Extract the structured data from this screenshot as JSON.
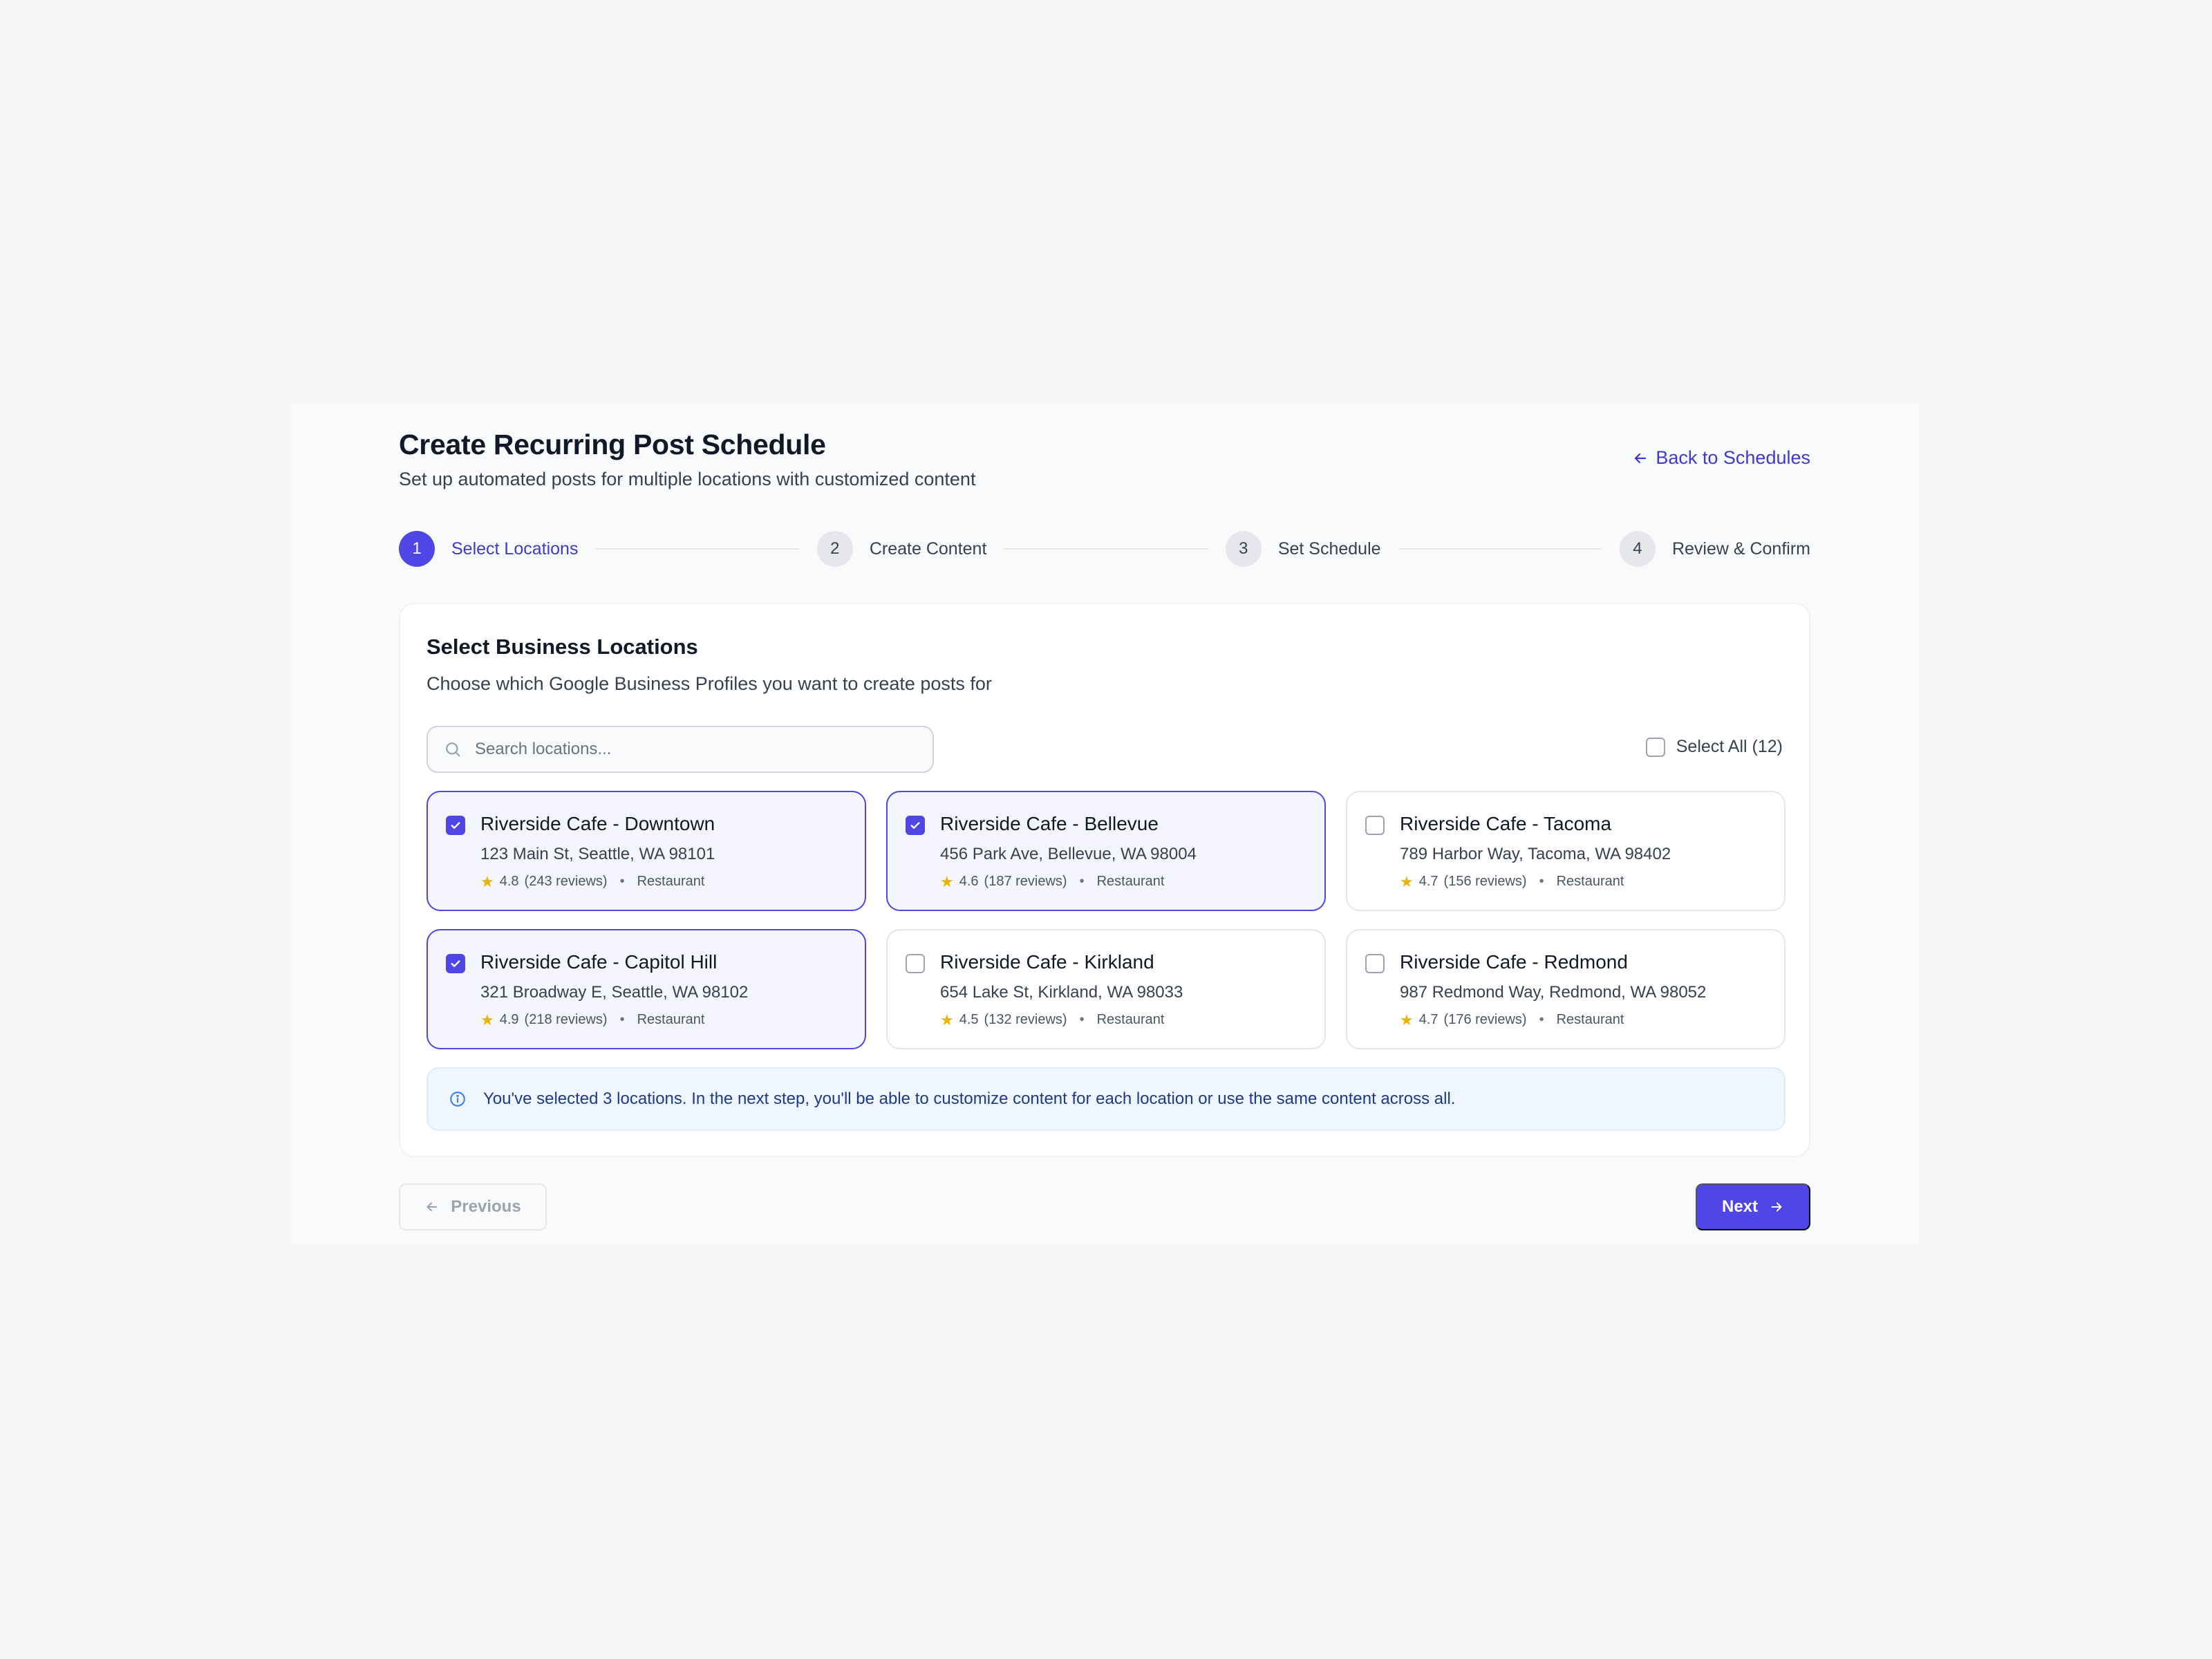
{
  "header": {
    "title": "Create Recurring Post Schedule",
    "subtitle": "Set up automated posts for multiple locations with customized content",
    "back_link": "Back to Schedules"
  },
  "stepper": {
    "current_step": 1,
    "steps": [
      {
        "number": "1",
        "label": "Select Locations"
      },
      {
        "number": "2",
        "label": "Create Content"
      },
      {
        "number": "3",
        "label": "Set Schedule"
      },
      {
        "number": "4",
        "label": "Review & Confirm"
      }
    ]
  },
  "card": {
    "title": "Select Business Locations",
    "subtitle": "Choose which Google Business Profiles you want to create posts for",
    "search_placeholder": "Search locations...",
    "select_all_label": "Select All (12)"
  },
  "locations": [
    {
      "name": "Riverside Cafe - Downtown",
      "address": "123 Main St, Seattle, WA 98101",
      "rating": "4.8",
      "reviews": "(243 reviews)",
      "category": "Restaurant",
      "selected": true
    },
    {
      "name": "Riverside Cafe - Bellevue",
      "address": "456 Park Ave, Bellevue, WA 98004",
      "rating": "4.6",
      "reviews": "(187 reviews)",
      "category": "Restaurant",
      "selected": true
    },
    {
      "name": "Riverside Cafe - Tacoma",
      "address": "789 Harbor Way, Tacoma, WA 98402",
      "rating": "4.7",
      "reviews": "(156 reviews)",
      "category": "Restaurant",
      "selected": false
    },
    {
      "name": "Riverside Cafe - Capitol Hill",
      "address": "321 Broadway E, Seattle, WA 98102",
      "rating": "4.9",
      "reviews": "(218 reviews)",
      "category": "Restaurant",
      "selected": true
    },
    {
      "name": "Riverside Cafe - Kirkland",
      "address": "654 Lake St, Kirkland, WA 98033",
      "rating": "4.5",
      "reviews": "(132 reviews)",
      "category": "Restaurant",
      "selected": false
    },
    {
      "name": "Riverside Cafe - Redmond",
      "address": "987 Redmond Way, Redmond, WA 98052",
      "rating": "4.7",
      "reviews": "(176 reviews)",
      "category": "Restaurant",
      "selected": false
    }
  ],
  "info_message": "You've selected 3 locations. In the next step, you'll be able to customize content for each location or use the same content across all.",
  "footer": {
    "previous_label": "Previous",
    "next_label": "Next"
  },
  "colors": {
    "accent": "#4f46e5",
    "accent_text": "#4338ca",
    "star": "#eab308",
    "info_bg": "#eff6ff",
    "info_text": "#1e3a8a"
  },
  "icons": {
    "back": "arrow-left-icon",
    "search": "search-icon",
    "check": "check-icon",
    "star": "star-icon",
    "info": "info-icon",
    "previous": "arrow-left-icon",
    "next": "arrow-right-icon"
  }
}
